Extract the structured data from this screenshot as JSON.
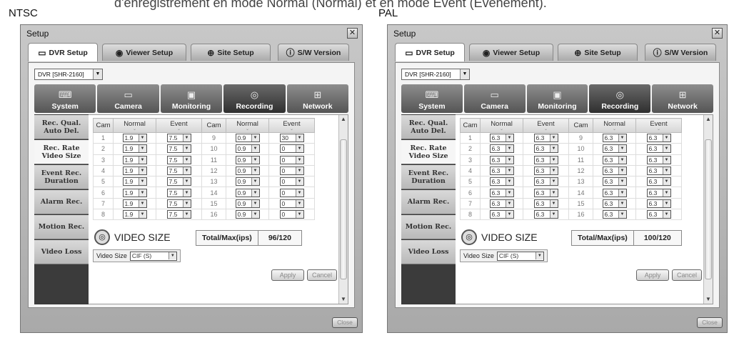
{
  "caption": "d'enregistrement en mode Normal (Normal) et en mode Event (Événement).",
  "labels": {
    "ntsc": "NTSC",
    "pal": "PAL"
  },
  "common": {
    "window_title": "Setup",
    "close_x": "✕",
    "tabs": [
      "DVR Setup",
      "Viewer Setup",
      "Site Setup",
      "S/W Version"
    ],
    "dvr_select": "DVR [SHR-2160]",
    "categories": [
      "System",
      "Camera",
      "Monitoring",
      "Recording",
      "Network"
    ],
    "side_items": [
      "Rec. Qual. Auto Del.",
      "Rec. Rate Video Size",
      "Event Rec. Duration",
      "Alarm Rec.",
      "Motion Rec.",
      "Video Loss"
    ],
    "headers": [
      "Cam",
      "Normal",
      "Event",
      "Cam",
      "Normal",
      "Event"
    ],
    "video_size_title": "VIDEO SIZE",
    "total_label": "Total/Max(ips)",
    "video_size_label": "Video Size",
    "video_size_value": "CIF (S)",
    "apply": "Apply",
    "cancel": "Cancel",
    "close": "Close"
  },
  "ntsc": {
    "total_value": "96/120",
    "rows": [
      [
        "1",
        "1.9",
        "7.5",
        "9",
        "0.9",
        "30"
      ],
      [
        "2",
        "1.9",
        "7.5",
        "10",
        "0.9",
        "0"
      ],
      [
        "3",
        "1.9",
        "7.5",
        "11",
        "0.9",
        "0"
      ],
      [
        "4",
        "1.9",
        "7.5",
        "12",
        "0.9",
        "0"
      ],
      [
        "5",
        "1.9",
        "7.5",
        "13",
        "0.9",
        "0"
      ],
      [
        "6",
        "1.9",
        "7.5",
        "14",
        "0.9",
        "0"
      ],
      [
        "7",
        "1.9",
        "7.5",
        "15",
        "0.9",
        "0"
      ],
      [
        "8",
        "1.9",
        "7.5",
        "16",
        "0.9",
        "0"
      ]
    ]
  },
  "pal": {
    "total_value": "100/120",
    "rows": [
      [
        "1",
        "6.3",
        "6.3",
        "9",
        "6.3",
        "6.3"
      ],
      [
        "2",
        "6.3",
        "6.3",
        "10",
        "6.3",
        "6.3"
      ],
      [
        "3",
        "6.3",
        "6.3",
        "11",
        "6.3",
        "6.3"
      ],
      [
        "4",
        "6.3",
        "6.3",
        "12",
        "6.3",
        "6.3"
      ],
      [
        "5",
        "6.3",
        "6.3",
        "13",
        "6.3",
        "6.3"
      ],
      [
        "6",
        "6.3",
        "6.3",
        "14",
        "6.3",
        "6.3"
      ],
      [
        "7",
        "6.3",
        "6.3",
        "15",
        "6.3",
        "6.3"
      ],
      [
        "8",
        "6.3",
        "6.3",
        "16",
        "6.3",
        "6.3"
      ]
    ]
  }
}
